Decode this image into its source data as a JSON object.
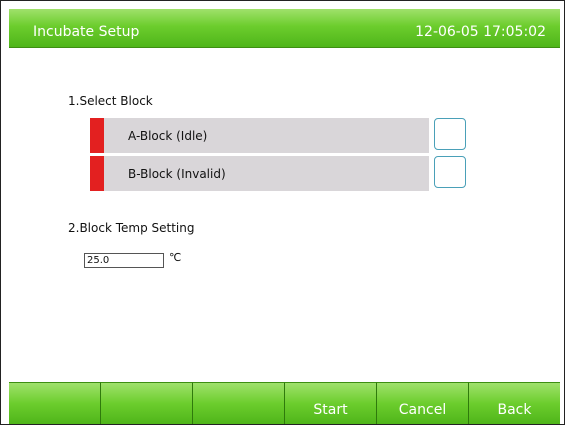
{
  "header": {
    "title": "Incubate Setup",
    "datetime": "12-06-05 17:05:02"
  },
  "select_block": {
    "heading": "1.Select Block",
    "blocks": [
      {
        "label": "A-Block (Idle)",
        "checked": false
      },
      {
        "label": "B-Block (Invalid)",
        "checked": false
      }
    ]
  },
  "temp_setting": {
    "heading": "2.Block Temp Setting",
    "value": "25.0",
    "unit": "℃"
  },
  "bottom_bar": {
    "buttons": [
      "",
      "",
      "",
      "Start",
      "Cancel",
      "Back"
    ]
  },
  "colors": {
    "header_green": "#6ccd2d",
    "block_marker_red": "#e32020",
    "block_row_gray": "#d9d6d9",
    "checkbox_border": "#4aa0b8"
  }
}
